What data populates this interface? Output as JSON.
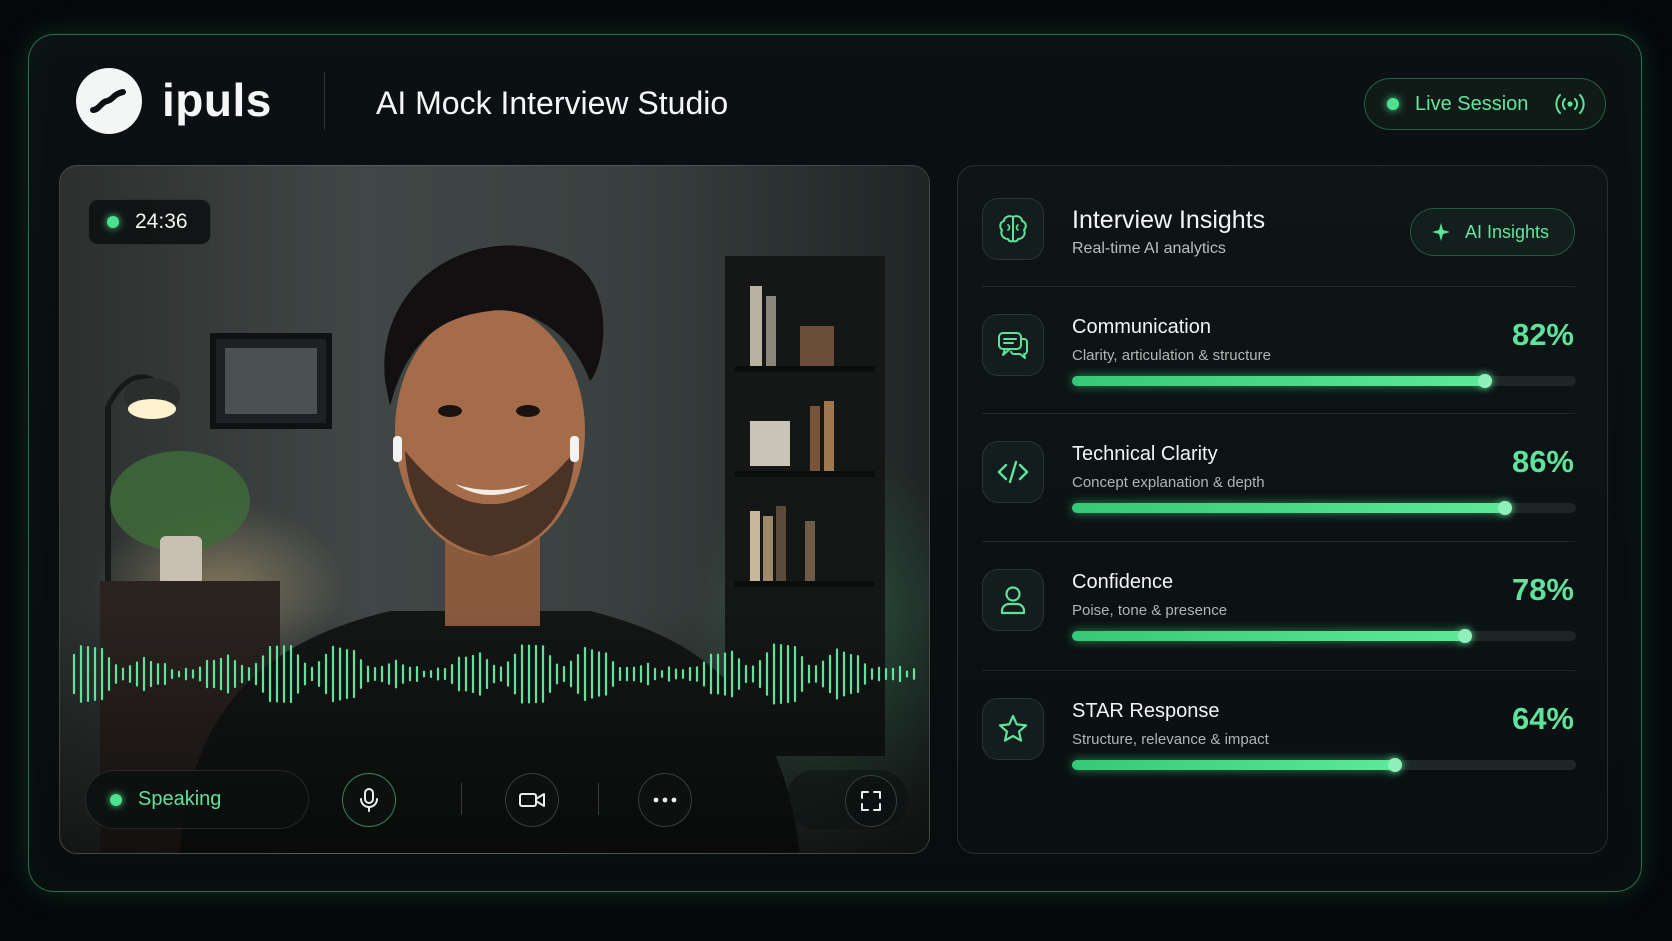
{
  "header": {
    "brand": "ipuls",
    "title": "AI Mock Interview Studio",
    "live_label": "Live Session"
  },
  "video": {
    "timer": "24:36",
    "speaking_label": "Speaking",
    "controls": [
      "mic-icon",
      "video-camera-icon",
      "more-icon",
      "fullscreen-icon"
    ]
  },
  "insights": {
    "title": "Interview Insights",
    "subtitle": "Real-time AI analytics",
    "ai_label": "AI Insights",
    "metrics": [
      {
        "name": "Communication",
        "desc": "Clarity, articulation & structure",
        "value": "82%",
        "progress": 0.82,
        "icon": "chat-icon"
      },
      {
        "name": "Technical Clarity",
        "desc": "Concept explanation & depth",
        "value": "86%",
        "progress": 0.86,
        "icon": "code-icon"
      },
      {
        "name": "Confidence",
        "desc": "Poise, tone & presence",
        "value": "78%",
        "progress": 0.78,
        "icon": "user-icon"
      },
      {
        "name": "STAR Response",
        "desc": "Structure, relevance & impact",
        "value": "64%",
        "progress": 0.64,
        "icon": "star-icon"
      }
    ]
  },
  "colors": {
    "accent": "#5fe29a",
    "background": "#05080a"
  }
}
